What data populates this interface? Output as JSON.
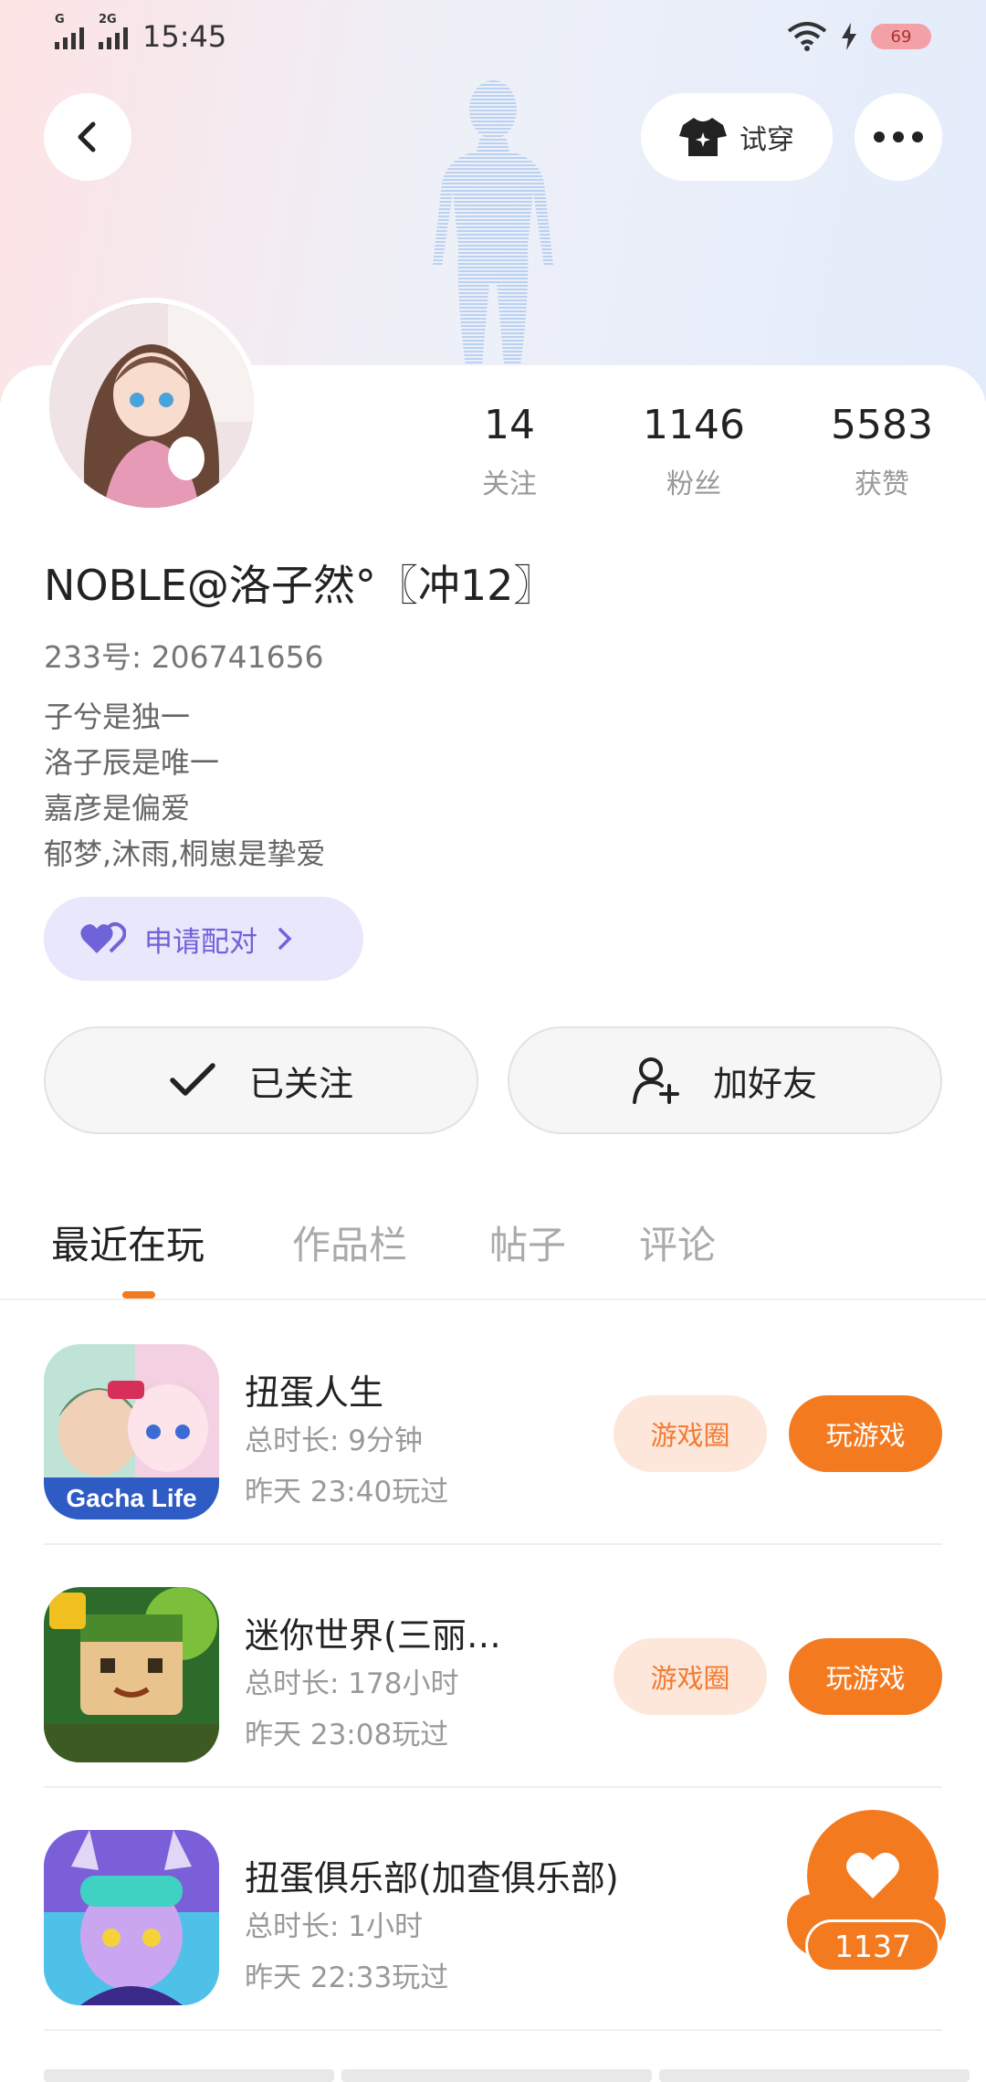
{
  "status_bar": {
    "time": "15:45",
    "signal1_label": "G",
    "signal2_label": "2G",
    "battery": "69"
  },
  "header": {
    "try_on_label": "试穿"
  },
  "profile": {
    "stats": [
      {
        "value": "14",
        "label": "关注"
      },
      {
        "value": "1146",
        "label": "粉丝"
      },
      {
        "value": "5583",
        "label": "获赞"
      }
    ],
    "nickname": "NOBLE@洛子然°〖冲12〗",
    "uid": "233号: 206741656",
    "bio": [
      "子兮是独一",
      "洛子辰是唯一",
      "嘉彦是偏爱",
      "郁梦,沐雨,桐崽是挚爱"
    ],
    "pair_label": "申请配对",
    "followed_label": "已关注",
    "add_friend_label": "加好友"
  },
  "tabs": [
    "最近在玩",
    "作品栏",
    "帖子",
    "评论"
  ],
  "games": [
    {
      "name": "扭蛋人生",
      "duration": "总时长: 9分钟",
      "last_played": "昨天 23:40玩过",
      "circle_label": "游戏圈",
      "play_label": "玩游戏",
      "icon_text": "Gacha Life"
    },
    {
      "name": "迷你世界(三丽…",
      "duration": "总时长: 178小时",
      "last_played": "昨天 23:08玩过",
      "circle_label": "游戏圈",
      "play_label": "玩游戏"
    },
    {
      "name": "扭蛋俱乐部(加查俱乐部)",
      "duration": "总时长: 1小时",
      "last_played": "昨天 22:33玩过"
    }
  ],
  "like_fab": {
    "count": "1137"
  },
  "colors": {
    "accent": "#f47a20",
    "pair": "#6e63d8",
    "pair_bg": "#e8e7fb"
  }
}
